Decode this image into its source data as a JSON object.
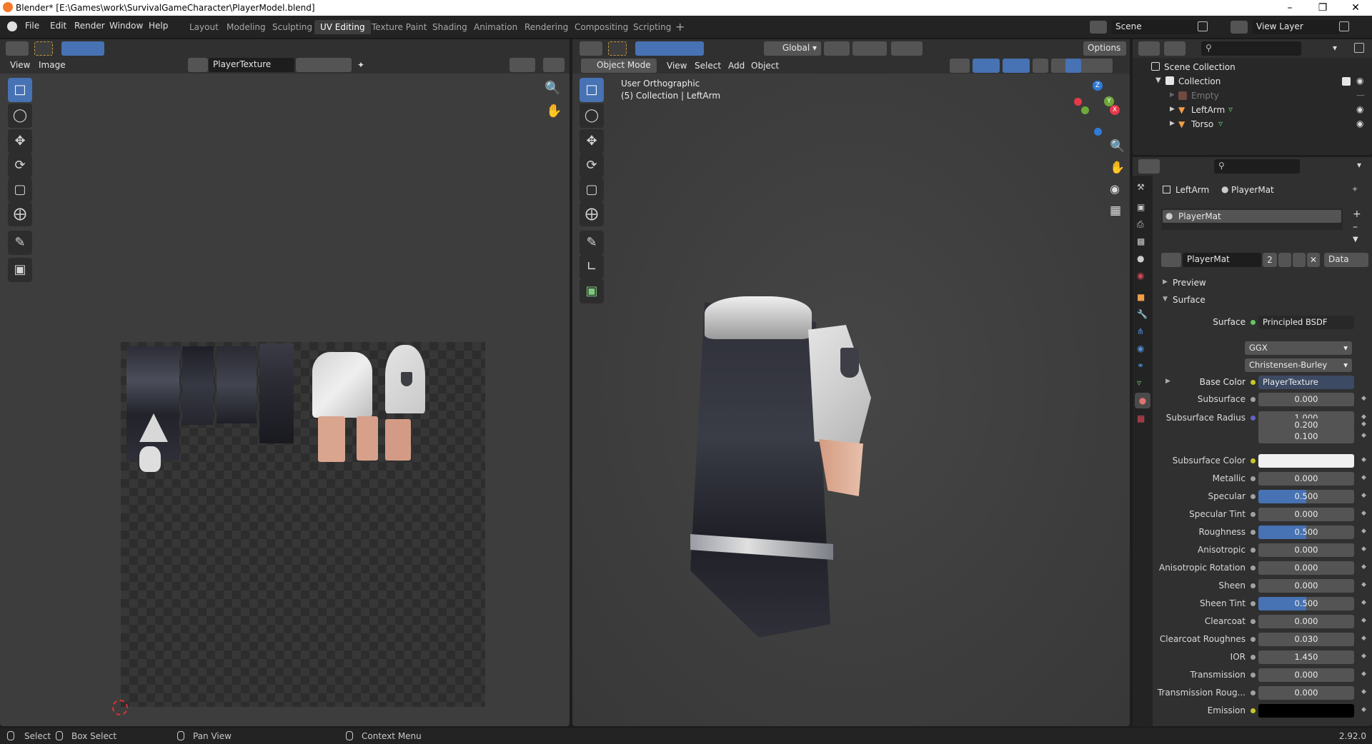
{
  "window": {
    "title": "Blender* [E:\\Games\\work\\SurvivalGameCharacter\\PlayerModel.blend]"
  },
  "menu": [
    "File",
    "Edit",
    "Render",
    "Window",
    "Help"
  ],
  "workspaces": [
    "Layout",
    "Modeling",
    "Sculpting",
    "UV Editing",
    "Texture Paint",
    "Shading",
    "Animation",
    "Rendering",
    "Compositing",
    "Scripting"
  ],
  "active_workspace": "UV Editing",
  "scene": {
    "name": "Scene",
    "view_layer": "View Layer"
  },
  "image_editor": {
    "view": "View",
    "image": "Image",
    "texture": "PlayerTexture"
  },
  "viewport": {
    "mode": "Object Mode",
    "menus": [
      "View",
      "Select",
      "Add",
      "Object"
    ],
    "orientation": "Global",
    "options": "Options",
    "overlay_line1": "User Orthographic",
    "overlay_line2": "(5) Collection | LeftArm"
  },
  "outliner": {
    "scene_collection": "Scene Collection",
    "collection": "Collection",
    "items": [
      {
        "name": "Empty",
        "dim": true
      },
      {
        "name": "LeftArm",
        "dim": false
      },
      {
        "name": "Torso",
        "dim": false
      }
    ]
  },
  "properties": {
    "object": "LeftArm",
    "material": "PlayerMat",
    "slot": "PlayerMat",
    "users": "2",
    "link": "Data",
    "preview": "Preview",
    "surface_panel": "Surface",
    "surface": {
      "label": "Surface",
      "value": "Principled BSDF"
    },
    "distribution": "GGX",
    "subsurface_method": "Christensen-Burley",
    "base_color": {
      "label": "Base Color",
      "value": "PlayerTexture"
    },
    "rows": [
      {
        "label": "Subsurface",
        "value": "0.000"
      },
      {
        "label": "Subsurface Radius",
        "value": "1.000"
      },
      {
        "label": "",
        "value": "0.200"
      },
      {
        "label": "",
        "value": "0.100"
      },
      {
        "label": "Subsurface Color",
        "value": ""
      },
      {
        "label": "Metallic",
        "value": "0.000"
      },
      {
        "label": "Specular",
        "value": "0.500"
      },
      {
        "label": "Specular Tint",
        "value": "0.000"
      },
      {
        "label": "Roughness",
        "value": "0.500"
      },
      {
        "label": "Anisotropic",
        "value": "0.000"
      },
      {
        "label": "Anisotropic Rotation",
        "value": "0.000"
      },
      {
        "label": "Sheen",
        "value": "0.000"
      },
      {
        "label": "Sheen Tint",
        "value": "0.500"
      },
      {
        "label": "Clearcoat",
        "value": "0.000"
      },
      {
        "label": "Clearcoat Roughnes",
        "value": "0.030"
      },
      {
        "label": "IOR",
        "value": "1.450"
      },
      {
        "label": "Transmission",
        "value": "0.000"
      },
      {
        "label": "Transmission Roug...",
        "value": "0.000"
      },
      {
        "label": "Emission",
        "value": ""
      }
    ]
  },
  "statusbar": {
    "select": "Select",
    "box_select": "Box Select",
    "pan": "Pan View",
    "context": "Context Menu",
    "version": "2.92.0"
  },
  "colors": {
    "accent": "#4772b3",
    "bg": "#303030"
  }
}
